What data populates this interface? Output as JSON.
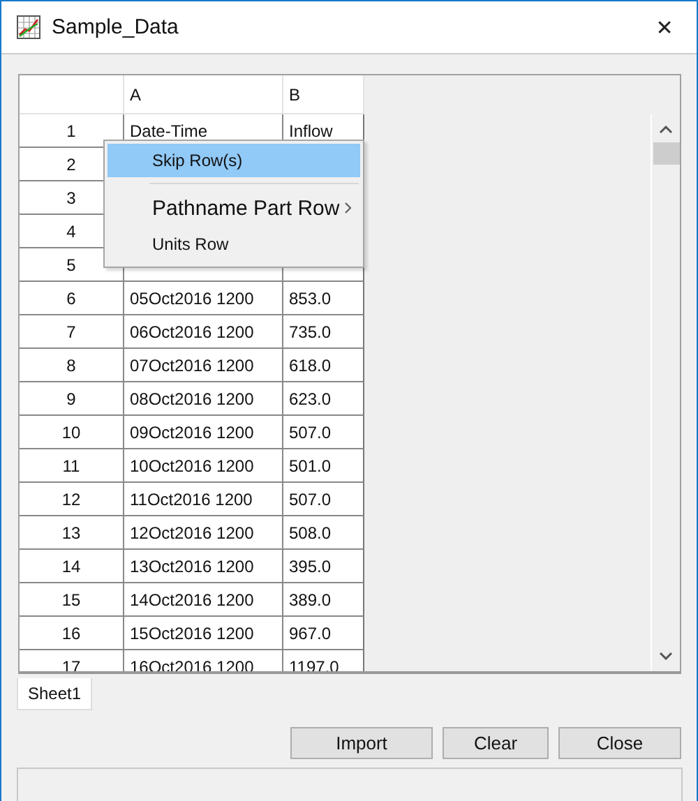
{
  "window": {
    "title": "Sample_Data",
    "close": "✕"
  },
  "table": {
    "columns": [
      {
        "label": "A"
      },
      {
        "label": "B"
      }
    ],
    "rows": [
      {
        "number": "1",
        "cells": [
          "Date-Time",
          "Inflow"
        ]
      },
      {
        "number": "2",
        "cells": []
      },
      {
        "number": "3",
        "cells": []
      },
      {
        "number": "4",
        "cells": []
      },
      {
        "number": "5",
        "cells": []
      },
      {
        "number": "6",
        "cells": [
          "05Oct2016 1200",
          "853.0"
        ]
      },
      {
        "number": "7",
        "cells": [
          "06Oct2016 1200",
          "735.0"
        ]
      },
      {
        "number": "8",
        "cells": [
          "07Oct2016 1200",
          "618.0"
        ]
      },
      {
        "number": "9",
        "cells": [
          "08Oct2016 1200",
          "623.0"
        ]
      },
      {
        "number": "10",
        "cells": [
          "09Oct2016 1200",
          "507.0"
        ]
      },
      {
        "number": "11",
        "cells": [
          "10Oct2016 1200",
          "501.0"
        ]
      },
      {
        "number": "12",
        "cells": [
          "11Oct2016 1200",
          "507.0"
        ]
      },
      {
        "number": "13",
        "cells": [
          "12Oct2016 1200",
          "508.0"
        ]
      },
      {
        "number": "14",
        "cells": [
          "13Oct2016 1200",
          "395.0"
        ]
      },
      {
        "number": "15",
        "cells": [
          "14Oct2016 1200",
          "389.0"
        ]
      },
      {
        "number": "16",
        "cells": [
          "15Oct2016 1200",
          "967.0"
        ]
      },
      {
        "number": "17",
        "cells": [
          "16Oct2016 1200",
          "1197.0"
        ]
      }
    ]
  },
  "context_menu": {
    "items": [
      {
        "kind": "item",
        "label": "Skip Row(s)",
        "selected": true
      },
      {
        "kind": "separator"
      },
      {
        "kind": "submenu",
        "label": "Pathname Part Row",
        "selected": false
      },
      {
        "kind": "item",
        "label": "Units Row",
        "selected": false
      }
    ]
  },
  "sheet_tabs": [
    {
      "label": "Sheet1",
      "selected": true
    }
  ],
  "buttons": [
    "Import",
    "Clear",
    "Close"
  ]
}
